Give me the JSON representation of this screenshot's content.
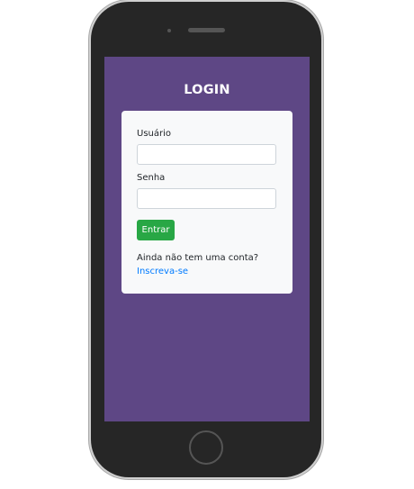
{
  "page": {
    "title": "LOGIN"
  },
  "form": {
    "username_label": "Usuário",
    "username_value": "",
    "password_label": "Senha",
    "password_value": "",
    "submit_label": "Entrar"
  },
  "signup": {
    "prompt": "Ainda não tem uma conta?",
    "link_label": "Inscreva-se"
  },
  "colors": {
    "screen_background": "#5e4785",
    "card_background": "#f8f9fa",
    "submit_button": "#28a745",
    "link": "#007bff",
    "phone_body": "#262626"
  }
}
